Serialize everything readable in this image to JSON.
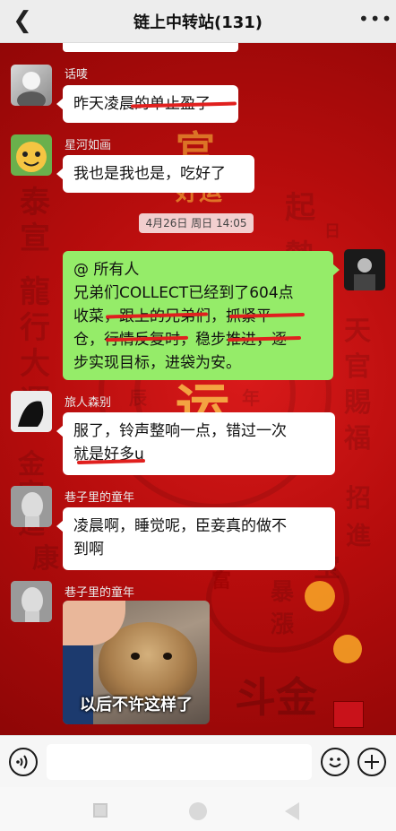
{
  "header": {
    "back_icon": "chevron-left-icon",
    "title": "链上中转站(131)",
    "more_icon": "more-dots-icon"
  },
  "background_text": {
    "left": [
      "泰",
      "宣",
      "龍",
      "行",
      "大",
      "運",
      "金",
      "家",
      "進",
      "康"
    ],
    "right": [
      "起",
      "勢",
      "日",
      "天",
      "官",
      "賜",
      "福",
      "招",
      "進",
      "宝",
      "暴",
      "漲"
    ],
    "gold": [
      "官",
      "好运",
      "运",
      "斗金",
      "富"
    ],
    "misc": [
      "辰",
      "年",
      "金",
      "斗",
      "金"
    ]
  },
  "messages": [
    {
      "id": "m1",
      "sender": "话唛",
      "text": "昨天凌晨的单止盈了"
    },
    {
      "id": "m2",
      "sender": "星河如画",
      "text": "我也是我也是，吃好了"
    },
    {
      "id": "ts",
      "timestamp": "4月26日 周日 14:05"
    },
    {
      "id": "m3",
      "sender": "me",
      "lines": [
        "@ 所有人",
        "兄弟们COLLECT已经到了604点",
        "收菜，跟上的兄弟们，抓紧平",
        "仓，行情反复时，稳步推进，逐",
        "步实现目标，进袋为安。"
      ]
    },
    {
      "id": "m4",
      "sender": "旅人森别",
      "lines": [
        "服了，铃声整响一点，错过一次",
        "就是好多u"
      ]
    },
    {
      "id": "m5",
      "sender": "巷子里的童年",
      "lines": [
        "凌晨啊，睡觉呢，臣妾真的做不",
        "到啊"
      ]
    },
    {
      "id": "m6",
      "sender": "巷子里的童年",
      "image_caption": "以后不许这样了"
    }
  ],
  "input_bar": {
    "voice_icon": "voice-icon",
    "emoji_icon": "emoji-icon",
    "plus_icon": "plus-icon"
  },
  "system_nav": {
    "recents": "recents-square-icon",
    "home": "home-circle-icon",
    "back": "back-triangle-icon"
  },
  "colors": {
    "chat_bg": "#b80d0d",
    "my_bubble": "#95ec69",
    "strikethrough": "#e0201e"
  }
}
